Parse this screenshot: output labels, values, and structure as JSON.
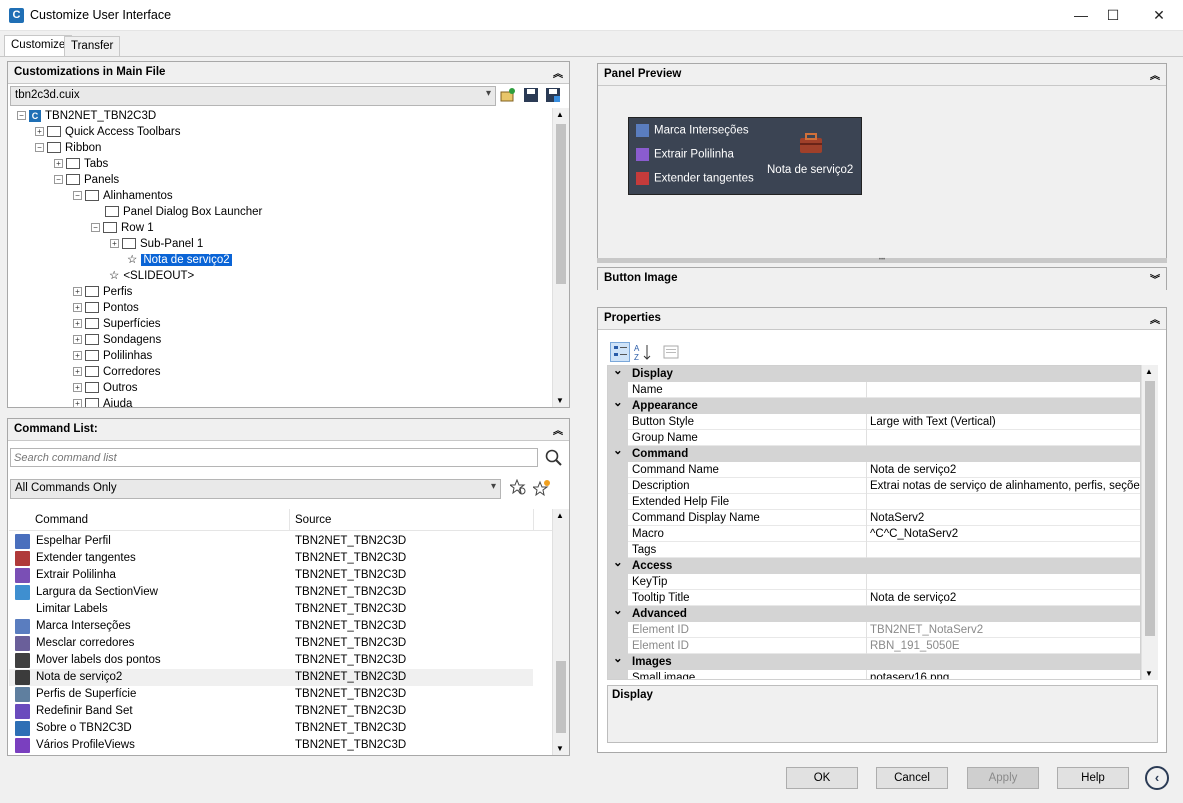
{
  "window": {
    "title": "Customize User Interface",
    "minimize": "—",
    "maximize": "☐",
    "close": "✕"
  },
  "tabs": [
    {
      "label": "Customize"
    },
    {
      "label": "Transfer"
    }
  ],
  "customizations": {
    "header": "Customizations in Main File",
    "file": "tbn2c3d.cuix",
    "tree": [
      {
        "label": "TBN2NET_TBN2C3D",
        "expander": "−"
      },
      {
        "label": "Quick Access Toolbars",
        "expander": "+"
      },
      {
        "label": "Ribbon",
        "expander": "−"
      },
      {
        "label": "Tabs",
        "expander": "+"
      },
      {
        "label": "Panels",
        "expander": "−"
      },
      {
        "label": "Alinhamentos",
        "expander": "−"
      },
      {
        "label": "Panel Dialog Box Launcher",
        "expander": ""
      },
      {
        "label": "Row 1",
        "expander": "−"
      },
      {
        "label": "Sub-Panel 1",
        "expander": "+"
      },
      {
        "label": "Nota de serviço2",
        "expander": ""
      },
      {
        "label": "<SLIDEOUT>",
        "expander": ""
      },
      {
        "label": "Perfis",
        "expander": "+"
      },
      {
        "label": "Pontos",
        "expander": "+"
      },
      {
        "label": "Superfícies",
        "expander": "+"
      },
      {
        "label": "Sondagens",
        "expander": "+"
      },
      {
        "label": "Polilinhas",
        "expander": "+"
      },
      {
        "label": "Corredores",
        "expander": "+"
      },
      {
        "label": "Outros",
        "expander": "+"
      },
      {
        "label": "Ajuda",
        "expander": "+"
      }
    ]
  },
  "command_list": {
    "header": "Command List:",
    "search_placeholder": "Search command list",
    "filter": "All Commands Only",
    "columns": {
      "command": "Command",
      "source": "Source"
    },
    "rows": [
      {
        "command": "Espelhar Perfil",
        "source": "TBN2NET_TBN2C3D"
      },
      {
        "command": "Extender tangentes",
        "source": "TBN2NET_TBN2C3D"
      },
      {
        "command": "Extrair Polilinha",
        "source": "TBN2NET_TBN2C3D"
      },
      {
        "command": "Largura da SectionView",
        "source": "TBN2NET_TBN2C3D"
      },
      {
        "command": "Limitar Labels",
        "source": "TBN2NET_TBN2C3D"
      },
      {
        "command": "Marca Interseções",
        "source": "TBN2NET_TBN2C3D"
      },
      {
        "command": "Mesclar corredores",
        "source": "TBN2NET_TBN2C3D"
      },
      {
        "command": "Mover labels dos pontos",
        "source": "TBN2NET_TBN2C3D"
      },
      {
        "command": "Nota de serviço2",
        "source": "TBN2NET_TBN2C3D"
      },
      {
        "command": "Perfis de Superfície",
        "source": "TBN2NET_TBN2C3D"
      },
      {
        "command": "Redefinir Band Set",
        "source": "TBN2NET_TBN2C3D"
      },
      {
        "command": "Sobre o TBN2C3D",
        "source": "TBN2NET_TBN2C3D"
      },
      {
        "command": "Vários ProfileViews",
        "source": "TBN2NET_TBN2C3D"
      }
    ]
  },
  "panel_preview": {
    "header": "Panel Preview",
    "items": [
      "Marca Interseções",
      "Extrair Polilinha",
      "Extender tangentes"
    ],
    "large_button": "Nota de serviço2"
  },
  "button_image": {
    "header": "Button Image"
  },
  "properties": {
    "header": "Properties",
    "rows": [
      {
        "cat": "Display"
      },
      {
        "name": "Name",
        "value": ""
      },
      {
        "cat": "Appearance"
      },
      {
        "name": "Button Style",
        "value": "Large with Text (Vertical)"
      },
      {
        "name": "Group Name",
        "value": ""
      },
      {
        "cat": "Command"
      },
      {
        "name": "Command Name",
        "value": "Nota de serviço2"
      },
      {
        "name": "Description",
        "value": "Extrai notas de serviço de alinhamento, perfis, seções, co"
      },
      {
        "name": "Extended Help File",
        "value": ""
      },
      {
        "name": "Command Display Name",
        "value": "NotaServ2"
      },
      {
        "name": "Macro",
        "value": "^C^C_NotaServ2"
      },
      {
        "name": "Tags",
        "value": ""
      },
      {
        "cat": "Access"
      },
      {
        "name": "KeyTip",
        "value": ""
      },
      {
        "name": "Tooltip Title",
        "value": "Nota de serviço2"
      },
      {
        "cat": "Advanced"
      },
      {
        "name": "Element ID",
        "value": "TBN2NET_NotaServ2",
        "disabled": true
      },
      {
        "name": "Element ID",
        "value": "RBN_191_5050E",
        "disabled": true
      },
      {
        "cat": "Images"
      },
      {
        "name": "Small image",
        "value": "notaserv16.png"
      }
    ],
    "description_title": "Display"
  },
  "buttons": {
    "ok": "OK",
    "cancel": "Cancel",
    "apply": "Apply",
    "help": "Help"
  },
  "colors": {
    "selection": "#0a64d6",
    "ribbon_bg": "#3b4453"
  }
}
